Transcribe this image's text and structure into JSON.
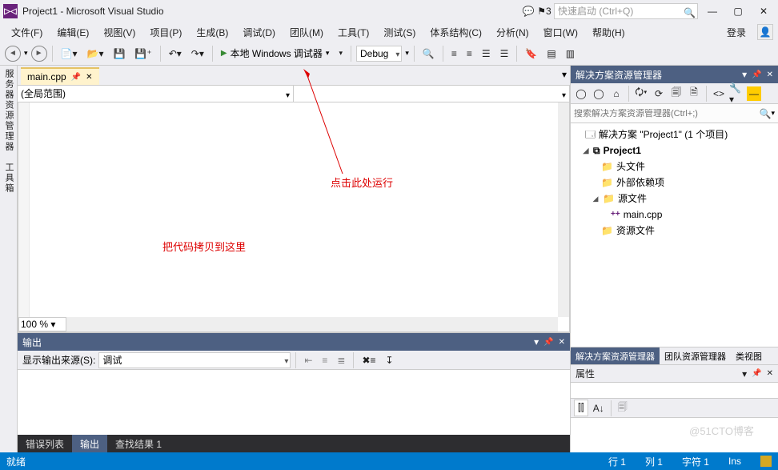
{
  "title": "Project1 - Microsoft Visual Studio",
  "flag_count": "3",
  "quicklaunch_placeholder": "快速启动 (Ctrl+Q)",
  "menu": [
    "文件(F)",
    "编辑(E)",
    "视图(V)",
    "项目(P)",
    "生成(B)",
    "调试(D)",
    "团队(M)",
    "工具(T)",
    "测试(S)",
    "体系结构(C)",
    "分析(N)",
    "窗口(W)",
    "帮助(H)"
  ],
  "login": "登录",
  "toolbar": {
    "debugger": "本地 Windows 调试器",
    "config": "Debug"
  },
  "doc_tab": "main.cpp",
  "scope": "(全局范围)",
  "zoom": "100 %",
  "side_tabs": "服务器资源管理器　工具箱",
  "annot1": "点击此处运行",
  "annot2": "把代码拷贝到这里",
  "output": {
    "title": "输出",
    "from_label": "显示输出来源(S):",
    "from_value": "调试",
    "tabs": [
      "错误列表",
      "输出",
      "查找结果 1"
    ]
  },
  "solexp": {
    "title": "解决方案资源管理器",
    "search_placeholder": "搜索解决方案资源管理器(Ctrl+;)",
    "solution": "解决方案 \"Project1\" (1 个项目)",
    "project": "Project1",
    "folders": {
      "headers": "头文件",
      "external": "外部依赖项",
      "sources": "源文件",
      "resources": "资源文件"
    },
    "file": "main.cpp",
    "bottom_tabs": [
      "解决方案资源管理器",
      "团队资源管理器",
      "类视图"
    ]
  },
  "props": {
    "title": "属性"
  },
  "status": {
    "ready": "就绪",
    "line": "行 1",
    "col": "列 1",
    "char": "字符 1",
    "ins": "Ins"
  },
  "watermark": "@51CTO博客"
}
